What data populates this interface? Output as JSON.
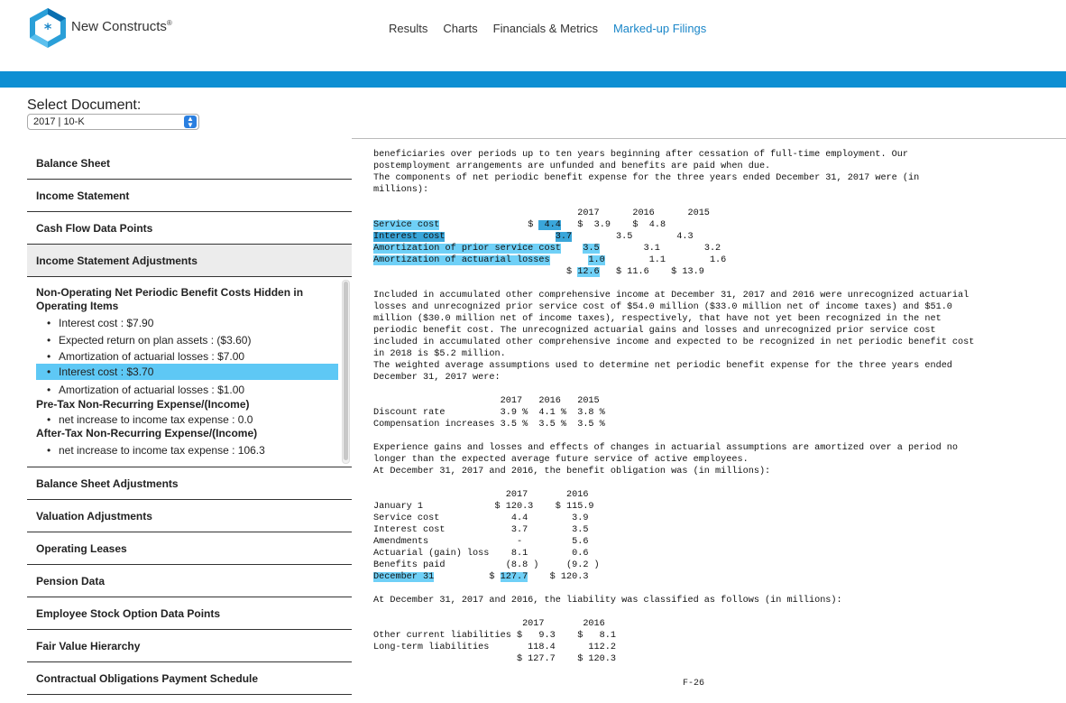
{
  "brand": {
    "name": "New Constructs",
    "mark": "®"
  },
  "nav": [
    "Results",
    "Charts",
    "Financials & Metrics",
    "Marked-up Filings"
  ],
  "select": {
    "label": "Select Document:",
    "value": "2017 | 10-K"
  },
  "sidebar_top": [
    "Balance Sheet",
    "Income Statement",
    "Cash Flow Data Points",
    "Income Statement Adjustments"
  ],
  "expanded": {
    "groups": [
      {
        "title": "Non-Operating Net Periodic Benefit Costs Hidden in Operating Items",
        "items": [
          "Interest cost : $7.90",
          "Expected return on plan assets : ($3.60)",
          "Amortization of actuarial losses : $7.00",
          "Interest cost : $3.70",
          "Amortization of actuarial losses : $1.00"
        ]
      },
      {
        "title": "Pre-Tax Non-Recurring Expense/(Income)",
        "items": [
          "net increase to income tax expense : 0.0"
        ]
      },
      {
        "title": "After-Tax Non-Recurring Expense/(Income)",
        "items": [
          "net increase to income tax expense : 106.3"
        ]
      }
    ]
  },
  "sidebar_bottom": [
    "Balance Sheet Adjustments",
    "Valuation Adjustments",
    "Operating Leases",
    "Pension Data",
    "Employee Stock Option Data Points",
    "Fair Value Hierarchy",
    "Contractual Obligations Payment Schedule"
  ],
  "doc": {
    "para1": "beneficiaries over periods up to ten years beginning after cessation of full-time employment. Our\npostemployment arrangements are unfunded and benefits are paid when due.\nThe components of net periodic benefit expense for the three years ended December 31, 2017 were (in\nmillions):",
    "t1_header": "                                     2017      2016      2015",
    "t1_rows": [
      {
        "label": "Service cost",
        "pre": "                ",
        "cur": "$ ",
        "v2017": " 4.4",
        "rest": "   $  3.9    $  4.8"
      },
      {
        "label": "Interest cost",
        "pre": "                    ",
        "cur": "",
        "v2017": "3.7",
        "rest": "        3.5        4.3"
      },
      {
        "label": "Amortization of prior service cost",
        "pre": "    ",
        "cur": "",
        "v2017": "3.5",
        "rest": "        3.1        3.2"
      },
      {
        "label": "Amortization of actuarial losses",
        "pre": "       ",
        "cur": "",
        "v2017": "1.0",
        "rest": "        1.1        1.6"
      }
    ],
    "t1_total_pre": "                                   $ ",
    "t1_total_2017": "12.6",
    "t1_total_rest": "   $ 11.6    $ 13.9",
    "para2": "Included in accumulated other comprehensive income at December 31, 2017 and 2016 were unrecognized actuarial\nlosses and unrecognized prior service cost of $54.0 million ($33.0 million net of income taxes) and $51.0\nmillion ($30.0 million net of income taxes), respectively, that have not yet been recognized in the net\nperiodic benefit cost. The unrecognized actuarial gains and losses and unrecognized prior service cost\nincluded in accumulated other comprehensive income and expected to be recognized in net periodic benefit cost\nin 2018 is $5.2 million.\nThe weighted average assumptions used to determine net periodic benefit expense for the three years ended\nDecember 31, 2017 were:",
    "t2": "                       2017   2016   2015\nDiscount rate          3.9 %  4.1 %  3.8 %\nCompensation increases 3.5 %  3.5 %  3.5 %",
    "para3": "Experience gains and losses and effects of changes in actuarial assumptions are amortized over a period no\nlonger than the expected average future service of active employees.\nAt December 31, 2017 and 2016, the benefit obligation was (in millions):",
    "t3": "                        2017       2016\nJanuary 1             $ 120.3    $ 115.9\nService cost             4.4        3.9\nInterest cost            3.7        3.5\nAmendments                -         5.6\nActuarial (gain) loss    8.1        0.6\nBenefits paid           (8.8 )     (9.2 )",
    "t3_last_label": "December 31",
    "t3_last_pre": "          $ ",
    "t3_last_v": "127.7",
    "t3_last_rest": "    $ 120.3",
    "para4": "At December 31, 2017 and 2016, the liability was classified as follows (in millions):",
    "t4": "                           2017       2016\nOther current liabilities $   9.3    $   8.1\nLong-term liabilities       118.4      112.2\n                          $ 127.7    $ 120.3",
    "page": "F-26"
  }
}
